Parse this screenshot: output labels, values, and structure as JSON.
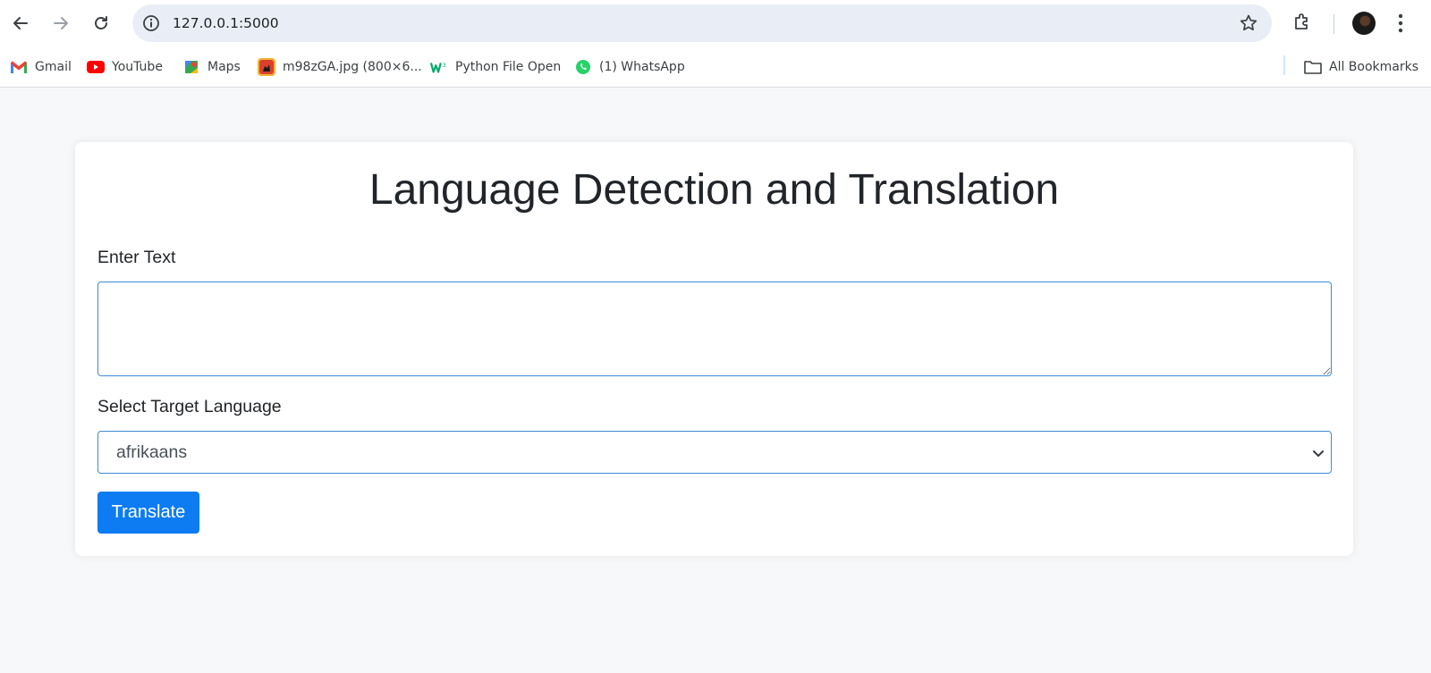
{
  "browser": {
    "url": "127.0.0.1:5000",
    "bookmarks": [
      {
        "label": "Gmail",
        "icon": "gmail-icon"
      },
      {
        "label": "YouTube",
        "icon": "youtube-icon"
      },
      {
        "label": "Maps",
        "icon": "maps-icon"
      },
      {
        "label": "m98zGA.jpg (800×6...",
        "icon": "image-favicon"
      },
      {
        "label": "Python File Open",
        "icon": "w3schools-icon"
      },
      {
        "label": "(1) WhatsApp",
        "icon": "whatsapp-icon"
      }
    ],
    "all_bookmarks_label": "All Bookmarks"
  },
  "page": {
    "title": "Language Detection and Translation",
    "text_label": "Enter Text",
    "text_value": "",
    "language_label": "Select Target Language",
    "language_selected": "afrikaans",
    "translate_label": "Translate"
  },
  "colors": {
    "accent": "#0d7cf2",
    "field_border": "#3d8bd6",
    "page_bg": "#f7f8fa"
  }
}
